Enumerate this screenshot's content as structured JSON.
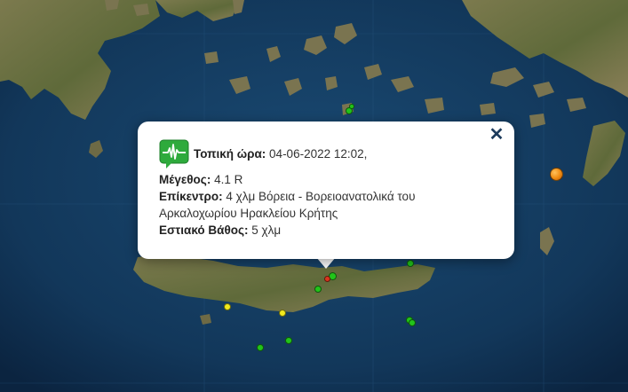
{
  "popup": {
    "time_label": "Τοπική ώρα:",
    "time_value": "04-06-2022 12:02,",
    "magnitude_label": "Μέγεθος:",
    "magnitude_value": "4.1 R",
    "epicenter_label": "Επίκεντρο:",
    "epicenter_value_line1": "4 χλμ Βόρεια - Βορειοανατολικά του",
    "epicenter_value_line2": "Αρκαλοχωρίου Ηρακλείου Κρήτης",
    "depth_label": "Εστιακό Βάθος:",
    "depth_value": "5 χλμ",
    "close_glyph": "✕",
    "icon": "seismograph-icon"
  },
  "colors": {
    "sea": "#123a5e",
    "land": "#6f7048",
    "green_marker": "#22c41a",
    "yellow_marker": "#f2ea1d",
    "orange_marker": "#ee8a10",
    "selected_marker": "#d9361d",
    "icon_bg": "#2eaa3c"
  },
  "markers": [
    {
      "color": "green"
    },
    {
      "color": "green"
    },
    {
      "color": "green"
    },
    {
      "color": "green"
    },
    {
      "color": "green"
    },
    {
      "color": "green"
    },
    {
      "color": "green"
    },
    {
      "color": "green"
    },
    {
      "color": "yellow"
    },
    {
      "color": "yellow"
    },
    {
      "color": "orange"
    },
    {
      "color": "selected"
    }
  ]
}
